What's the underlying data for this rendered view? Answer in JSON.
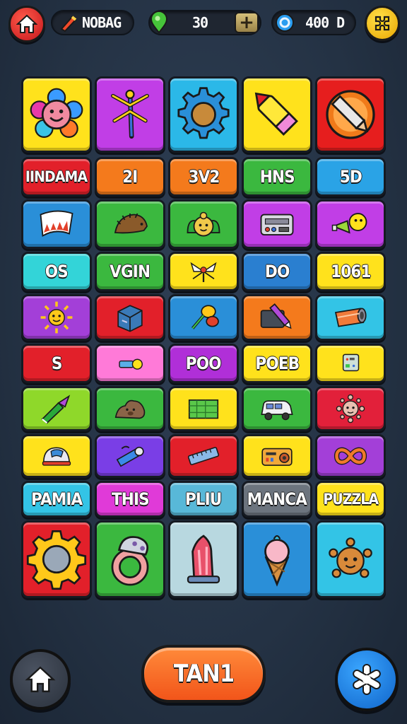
{
  "header": {
    "home_icon": "home-icon",
    "player_name": "NOBAG",
    "gems": "30",
    "gem_icon": "map-pin-gem-icon",
    "add_label": "+",
    "coins": "400 D",
    "coin_icon": "coin-icon",
    "settings_icon": "puzzle-settings-icon"
  },
  "grid": {
    "rows": [
      [
        {
          "type": "icon",
          "icon": "flower-face-icon",
          "color": "#ffe21c"
        },
        {
          "type": "icon",
          "icon": "dragonfly-icon",
          "color": "#c13ee6"
        },
        {
          "type": "icon",
          "icon": "gear-cog-icon",
          "color": "#2bb8e8"
        },
        {
          "type": "icon",
          "icon": "crayon-icon",
          "color": "#ffe21c"
        },
        {
          "type": "icon",
          "icon": "pencil-badge-icon",
          "color": "#e61e1e"
        }
      ],
      [
        {
          "type": "label",
          "label": "IINDAMA",
          "color": "#e2202a"
        },
        {
          "type": "label",
          "label": "2I",
          "color": "#f47a1c"
        },
        {
          "type": "label",
          "label": "3V2",
          "color": "#f47a1c"
        },
        {
          "type": "label",
          "label": "HNS",
          "color": "#3bb83f"
        },
        {
          "type": "label",
          "label": "5D",
          "color": "#2aa3e6"
        }
      ],
      [
        {
          "type": "icon",
          "icon": "flag-banner-icon",
          "color": "#2a8fd8"
        },
        {
          "type": "icon",
          "icon": "hedgehog-icon",
          "color": "#3bb83f"
        },
        {
          "type": "icon",
          "icon": "frog-face-icon",
          "color": "#3bb83f"
        },
        {
          "type": "icon",
          "icon": "radio-device-icon",
          "color": "#c13ee6"
        },
        {
          "type": "icon",
          "icon": "megaphone-chick-icon",
          "color": "#c13ee6"
        }
      ],
      [
        {
          "type": "label",
          "label": "OS",
          "color": "#33d4d8"
        },
        {
          "type": "label",
          "label": "VGIN",
          "color": "#3bb83f"
        },
        {
          "type": "icon",
          "icon": "winged-bug-icon",
          "color": "#ffe21c"
        },
        {
          "type": "label",
          "label": "DO",
          "color": "#2a7fd0"
        },
        {
          "type": "label",
          "label": "1061",
          "color": "#ffe21c"
        }
      ],
      [
        {
          "type": "icon",
          "icon": "sun-face-icon",
          "color": "#a33fd8"
        },
        {
          "type": "icon",
          "icon": "cube-box-icon",
          "color": "#e2202a"
        },
        {
          "type": "icon",
          "icon": "maracas-icon",
          "color": "#2a8fd8"
        },
        {
          "type": "icon",
          "icon": "marker-pen-icon",
          "color": "#f47a1c"
        },
        {
          "type": "icon",
          "icon": "pipe-tube-icon",
          "color": "#33c4e6"
        }
      ],
      [
        {
          "type": "label",
          "label": "S",
          "color": "#e2202a"
        },
        {
          "type": "icon",
          "icon": "flashlight-icon",
          "color": "#ff7ad8"
        },
        {
          "type": "label",
          "label": "POO",
          "color": "#b02fd8"
        },
        {
          "type": "label",
          "label": "POEB",
          "color": "#ffe21c"
        },
        {
          "type": "icon",
          "icon": "circuit-chip-icon",
          "color": "#ffe21c"
        }
      ],
      [
        {
          "type": "icon",
          "icon": "paint-brush-icon",
          "color": "#8fd82a"
        },
        {
          "type": "icon",
          "icon": "bear-rock-icon",
          "color": "#3bb83f"
        },
        {
          "type": "icon",
          "icon": "crate-box-icon",
          "color": "#ffe21c"
        },
        {
          "type": "icon",
          "icon": "van-car-icon",
          "color": "#3bb83f"
        },
        {
          "type": "icon",
          "icon": "virus-face-icon",
          "color": "#e2203a"
        }
      ],
      [
        {
          "type": "icon",
          "icon": "helmet-icon",
          "color": "#ffe21c"
        },
        {
          "type": "icon",
          "icon": "telescope-icon",
          "color": "#7a3ee6"
        },
        {
          "type": "icon",
          "icon": "ruler-bar-icon",
          "color": "#e2202a"
        },
        {
          "type": "icon",
          "icon": "tape-recorder-icon",
          "color": "#ffe21c"
        },
        {
          "type": "icon",
          "icon": "infinity-icon",
          "color": "#a33fd8"
        }
      ],
      [
        {
          "type": "label",
          "label": "PAMIA",
          "color": "#33c4e6"
        },
        {
          "type": "label",
          "label": "THIS",
          "color": "#e03ad8"
        },
        {
          "type": "label",
          "label": "PLIU",
          "color": "#58b8d8"
        },
        {
          "type": "label",
          "label": "MANCA",
          "color": "#6c747e"
        },
        {
          "type": "label",
          "label": "PUZZLA",
          "color": "#ffe21c"
        }
      ],
      [
        {
          "type": "icon",
          "icon": "big-gear-icon",
          "color": "#e2202a"
        },
        {
          "type": "icon",
          "icon": "ring-mushroom-icon",
          "color": "#3bb83f"
        },
        {
          "type": "icon",
          "icon": "crystal-vase-icon",
          "color": "#b8d8e0"
        },
        {
          "type": "icon",
          "icon": "ice-cream-cone-icon",
          "color": "#2a8fd8"
        },
        {
          "type": "icon",
          "icon": "germ-face-icon",
          "color": "#33c4e6"
        }
      ]
    ]
  },
  "footer": {
    "home_icon": "home-icon",
    "tap_label": "TAN1",
    "star_icon": "asterisk-star-icon"
  }
}
